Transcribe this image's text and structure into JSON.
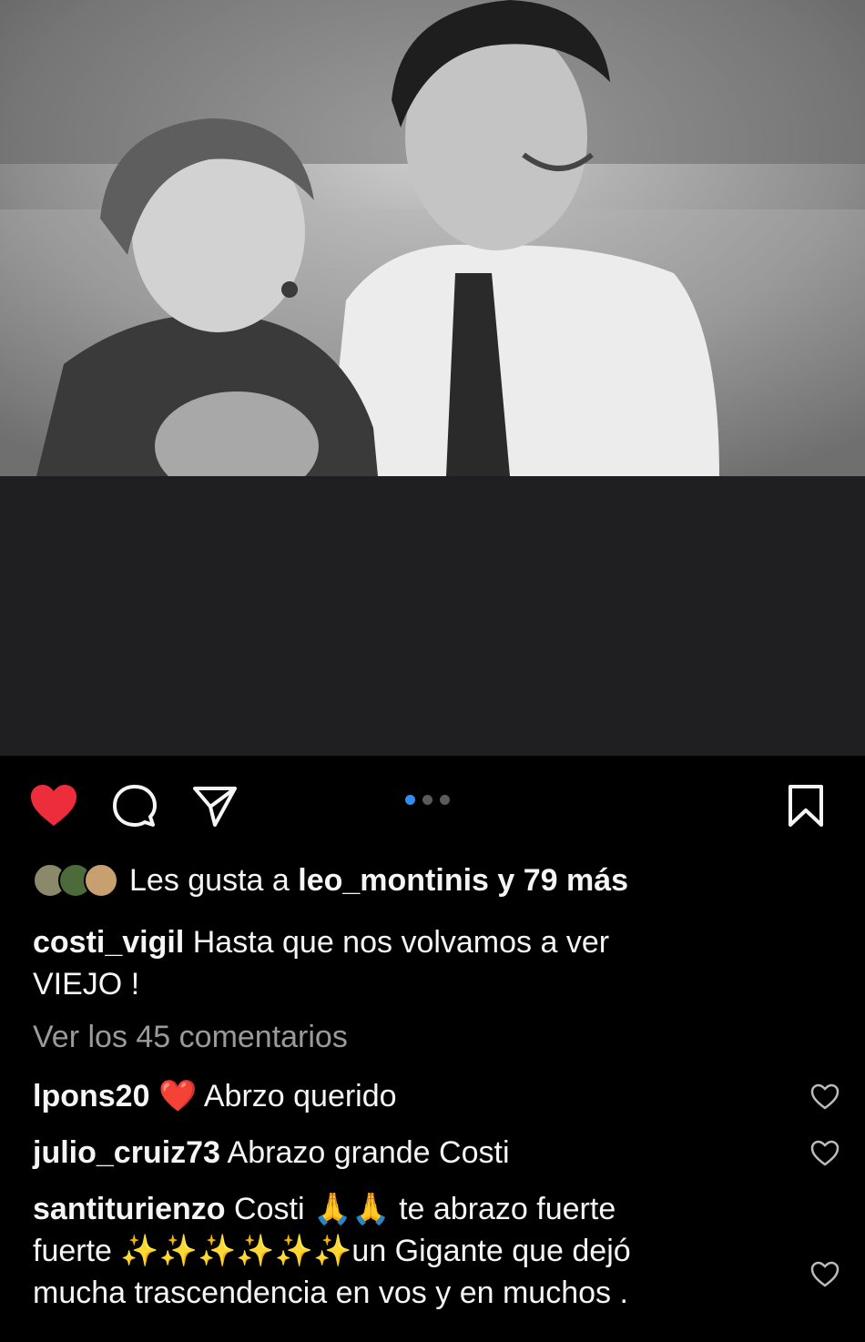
{
  "post": {
    "likes": {
      "prefix": "Les gusta a",
      "user": "leo_montinis",
      "suffix": "y 79 más"
    },
    "caption": {
      "user": "costi_vigil",
      "text_line1": "Hasta que nos volvamos a ver",
      "text_line2": "VIEJO !"
    },
    "view_comments": "Ver los 45 comentarios",
    "comments": [
      {
        "user": "lpons20",
        "emoji": "❤️",
        "text": "Abrzo querido"
      },
      {
        "user": "julio_cruiz73",
        "text": "Abrazo grande Costi"
      },
      {
        "user": "santiturienzo",
        "text_a": "Costi",
        "emoji_a": "🙏🙏",
        "text_b": "te abrazo fuerte",
        "text_c": "fuerte",
        "emoji_b": "✨✨✨✨✨✨",
        "text_d": "un Gigante que dejó",
        "text_e": "mucha trascendencia en vos y en muchos ."
      }
    ],
    "carousel": {
      "count": 3,
      "active": 0
    }
  },
  "icons": [
    "heart-icon",
    "comment-icon",
    "share-icon",
    "bookmark-icon",
    "like-outline-icon"
  ],
  "colors": {
    "heart": "#e8323a",
    "active_dot": "#2f8ef5",
    "background": "#000000",
    "band": "#1f1f21"
  }
}
